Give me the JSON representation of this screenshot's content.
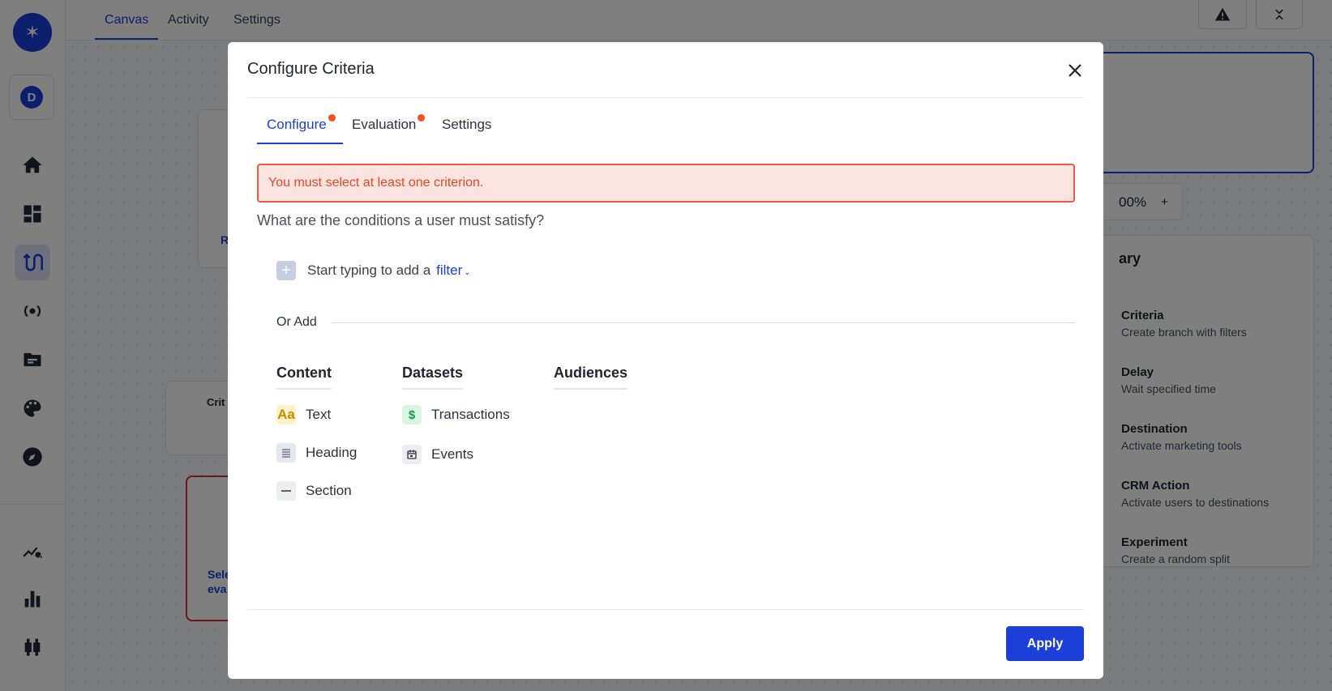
{
  "topnav": {
    "tabs": [
      "Canvas",
      "Activity",
      "Settings"
    ],
    "active": "Canvas"
  },
  "workspace": {
    "initial": "D"
  },
  "canvas": {
    "zoom_text": "00%",
    "zoom_plus": "+"
  },
  "library": {
    "heading_fragment": "ary",
    "items": [
      {
        "title": "Criteria",
        "desc": "Create branch with filters"
      },
      {
        "title": "Delay",
        "desc": "Wait specified time"
      },
      {
        "title": "Destination",
        "desc": "Activate marketing tools"
      },
      {
        "title": "CRM Action",
        "desc": "Activate users to destinations"
      },
      {
        "title": "Experiment",
        "desc": "Create a random split"
      }
    ]
  },
  "bg_fragments": {
    "crit": "Crit",
    "r": "R",
    "sele": "Sele",
    "eva": "eva"
  },
  "modal": {
    "title": "Configure Criteria",
    "tabs": [
      {
        "label": "Configure",
        "has_dot": true
      },
      {
        "label": "Evaluation",
        "has_dot": true
      },
      {
        "label": "Settings",
        "has_dot": false
      }
    ],
    "error": "You must select at least one criterion.",
    "question": "What are the conditions a user must satisfy?",
    "filter_prompt": "Start typing to add a",
    "filter_link": "filter",
    "or_add": "Or Add",
    "columns": {
      "content": {
        "heading": "Content",
        "items": [
          "Text",
          "Heading",
          "Section"
        ]
      },
      "datasets": {
        "heading": "Datasets",
        "items": [
          "Transactions",
          "Events"
        ]
      },
      "audiences": {
        "heading": "Audiences",
        "items": []
      }
    },
    "text_icon_glyph": "Aa",
    "transactions_icon_glyph": "$",
    "apply_label": "Apply"
  },
  "colors": {
    "accent": "#1b3fd8",
    "error_bg": "#fbe4df",
    "error_border": "#f0593f",
    "error_text": "#e4472a",
    "dot": "#f4511e"
  }
}
